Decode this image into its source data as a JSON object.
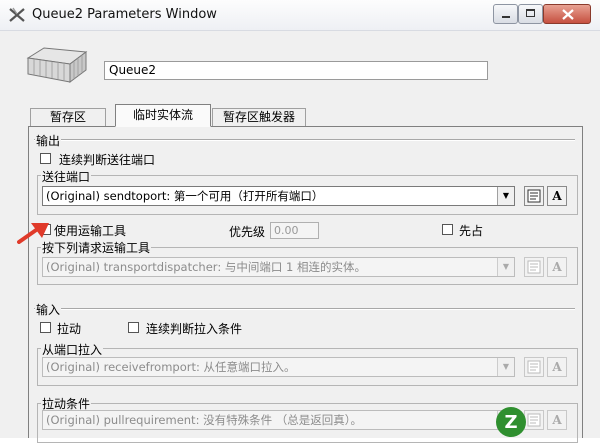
{
  "window": {
    "title": "Queue2  Parameters Window"
  },
  "object": {
    "name": "Queue2"
  },
  "tabs": [
    {
      "label": "暂存区"
    },
    {
      "label": "临时实体流"
    },
    {
      "label": "暂存区触发器"
    }
  ],
  "output": {
    "section_label": "输出",
    "continuous_eval_label": "连续判断送往端口",
    "send_to_port": {
      "group_label": "送往端口",
      "value": "(Original) sendtoport:  第一个可用（打开所有端口）"
    },
    "use_transport_label": "使用运输工具",
    "priority_label": "优先级",
    "priority_value": "0.00",
    "preempt_label": "先占",
    "transport_group": {
      "group_label": "按下列请求运输工具",
      "value": "(Original) transportdispatcher:  与中间端口 1  相连的实体。"
    }
  },
  "input": {
    "section_label": "输入",
    "pull_label": "拉动",
    "continuous_pull_label": "连续判断拉入条件",
    "pull_from_port": {
      "group_label": "从端口拉入",
      "value": "(Original) receivefromport:  从任意端口拉入。"
    },
    "pull_condition": {
      "group_label": "拉动条件",
      "value": "(Original) pullrequirement:  没有特殊条件  （总是返回真）。"
    }
  },
  "icons": {
    "edit_code": "code-editor-icon",
    "font_a": "A",
    "watermark": "Z"
  },
  "colors": {
    "watermark_green": "#2f8f2f",
    "arrow_red": "#e03a2a"
  }
}
